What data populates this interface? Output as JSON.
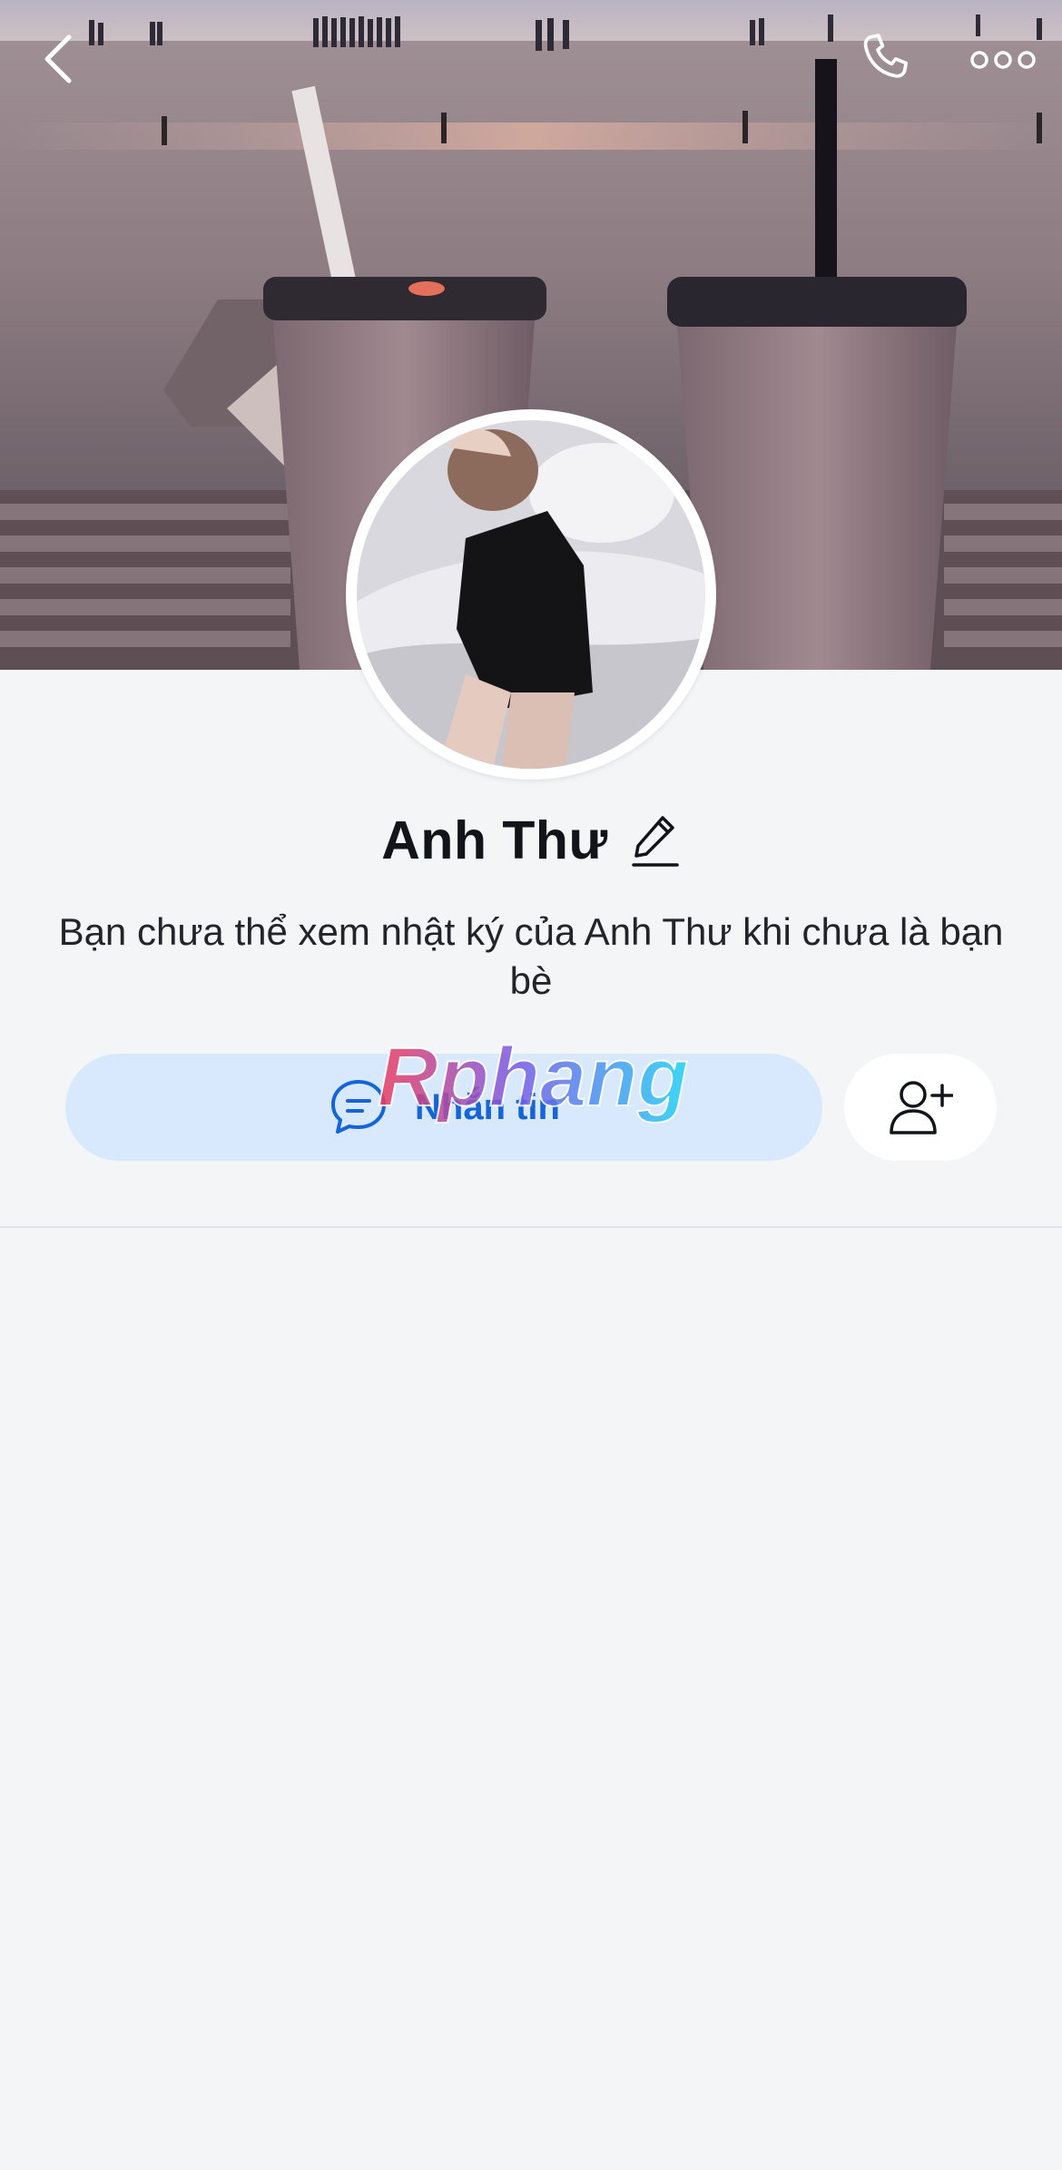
{
  "header": {
    "back_icon": "chevron-left-icon",
    "call_icon": "phone-icon",
    "more_icon": "more-horizontal-icon"
  },
  "profile": {
    "name": "Anh Thư",
    "edit_icon": "pencil-icon",
    "notice": "Bạn chưa thể xem nhật ký của Anh Thư khi chưa là bạn bè"
  },
  "actions": {
    "message_label": "Nhắn tin",
    "message_icon": "chat-bubble-icon",
    "add_friend_icon": "add-user-icon"
  },
  "watermark": {
    "text": "Rphang"
  },
  "colors": {
    "background": "#f4f5f7",
    "message_button_bg": "#d8e8fd",
    "message_button_text": "#1565d8",
    "text_primary": "#111418"
  }
}
